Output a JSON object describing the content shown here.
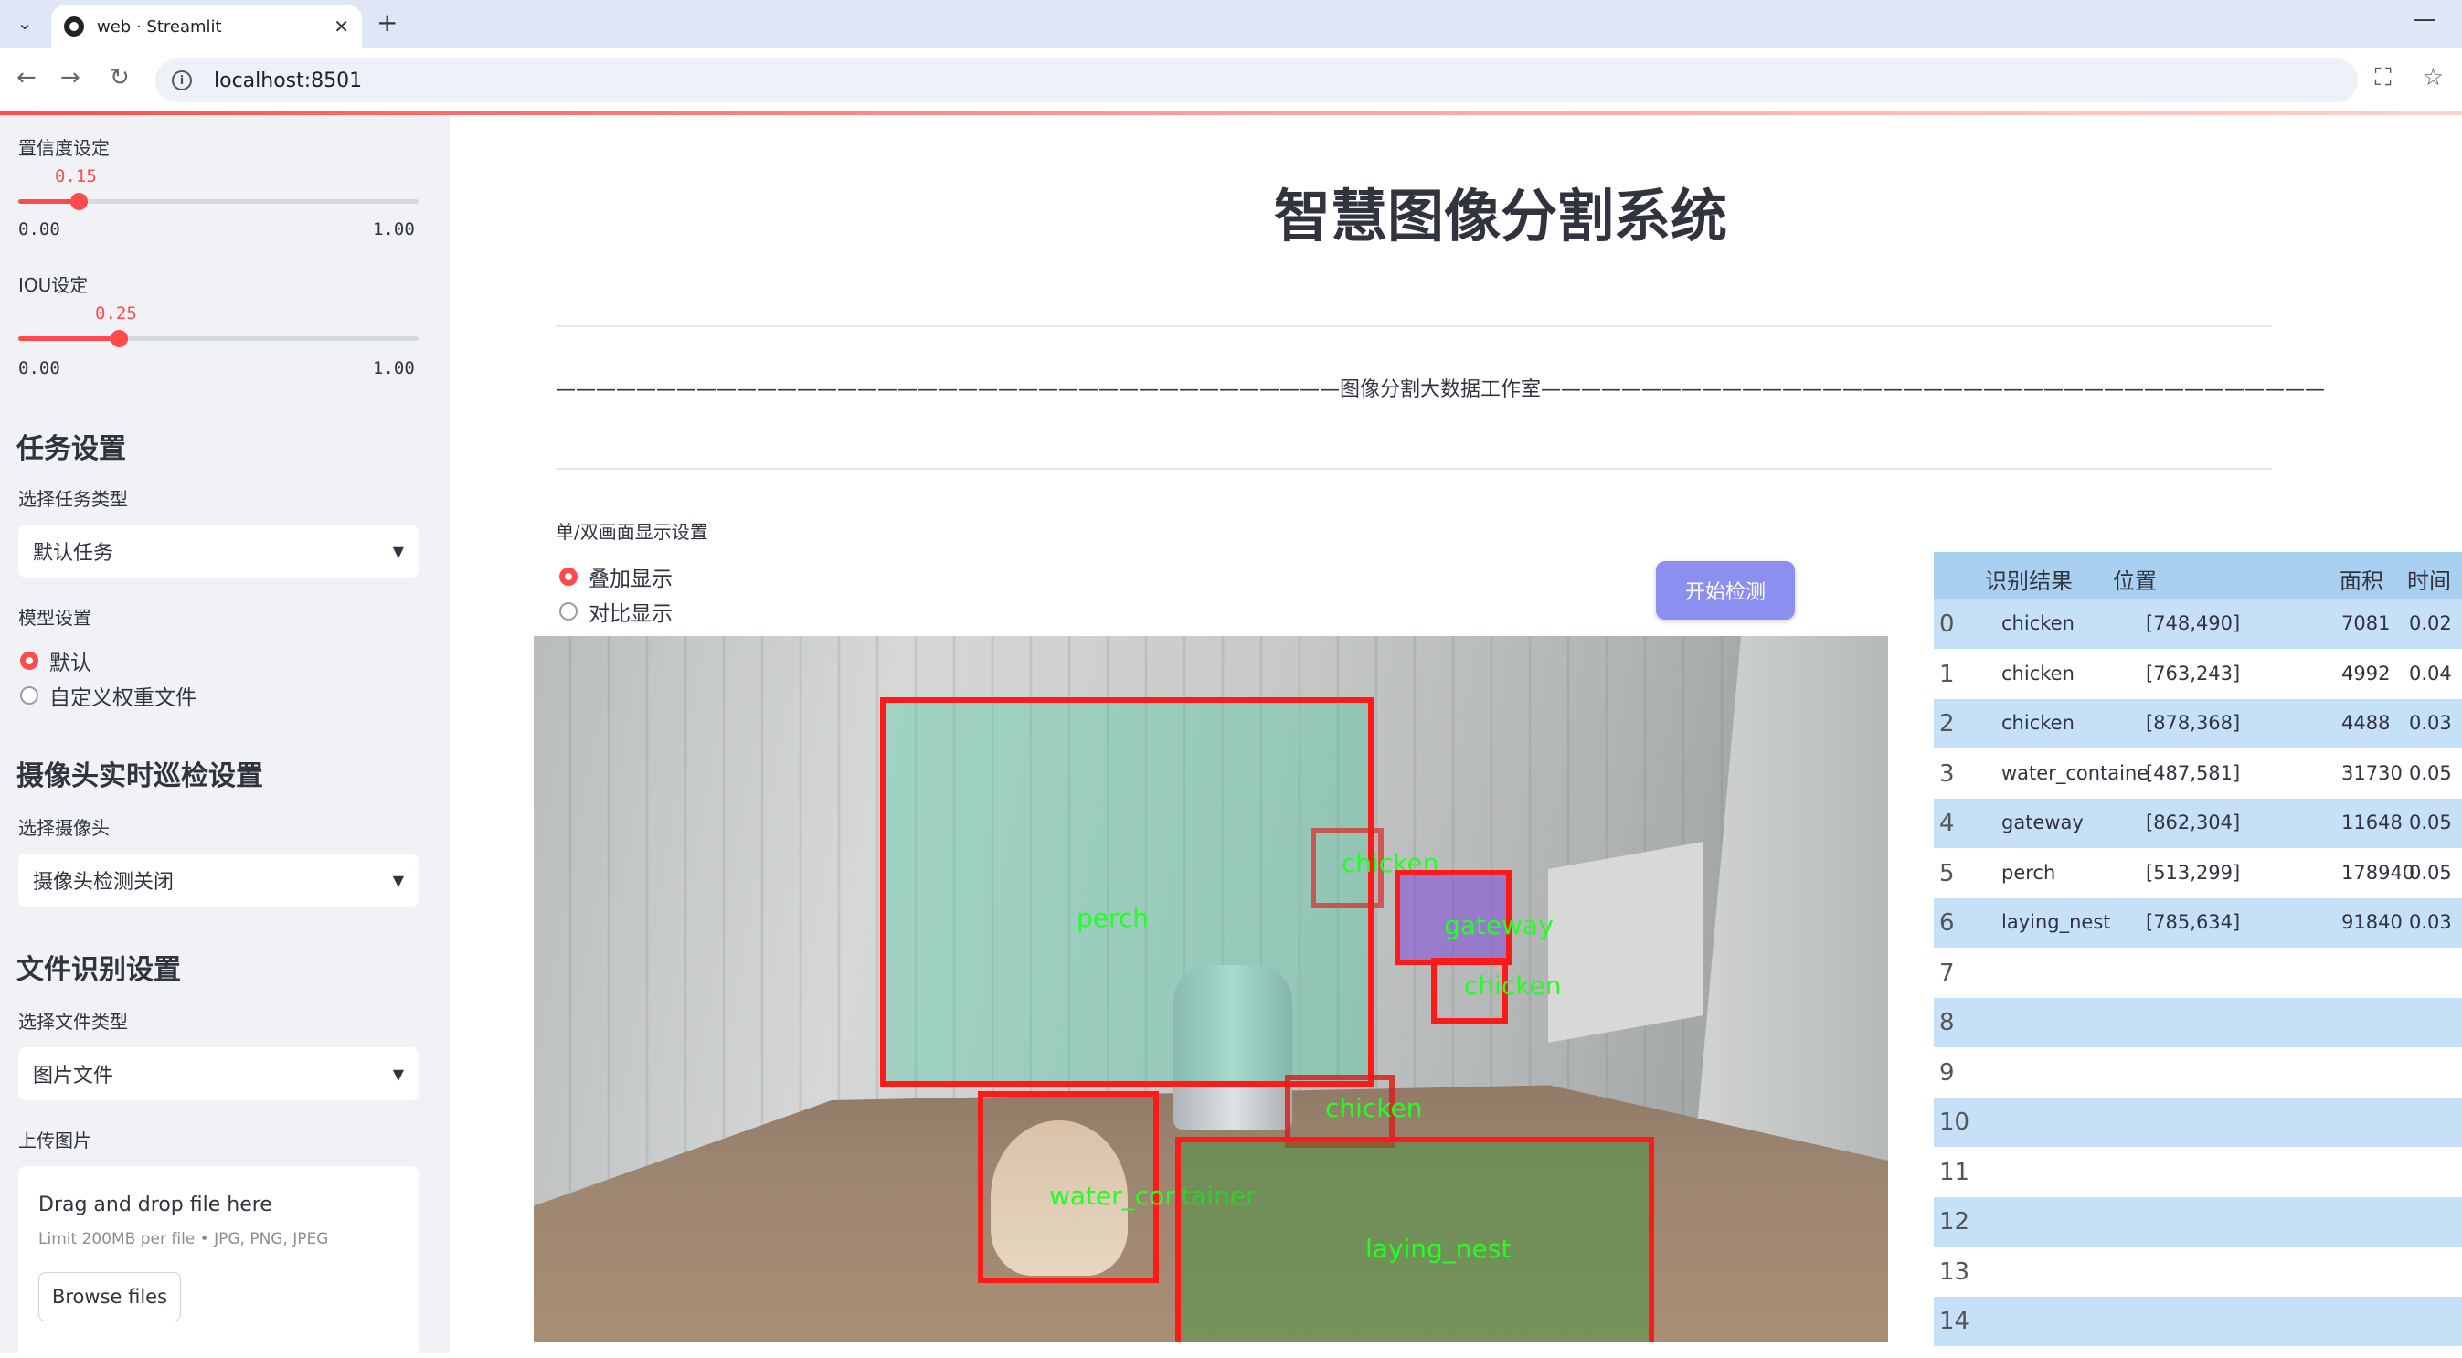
{
  "browser": {
    "tab_title": "web · Streamlit",
    "url": "localhost:8501"
  },
  "sidebar": {
    "confidence": {
      "label": "置信度设定",
      "value": "0.15",
      "value_fraction": 0.15,
      "min": "0.00",
      "max": "1.00"
    },
    "iou": {
      "label": "IOU设定",
      "value": "0.25",
      "value_fraction": 0.25,
      "min": "0.00",
      "max": "1.00"
    },
    "task_header": "任务设置",
    "task_type_label": "选择任务类型",
    "task_type_value": "默认任务",
    "model_label": "模型设置",
    "model_options": [
      "默认",
      "自定义权重文件"
    ],
    "camera_header": "摄像头实时巡检设置",
    "camera_label": "选择摄像头",
    "camera_value": "摄像头检测关闭",
    "file_header": "文件识别设置",
    "file_type_label": "选择文件类型",
    "file_type_value": "图片文件",
    "upload_label": "上传图片",
    "upload_title": "Drag and drop file here",
    "upload_limit": "Limit 200MB per file • JPG, PNG, JPEG",
    "browse_label": "Browse files"
  },
  "main": {
    "title": "智慧图像分割系统",
    "studio_line": "———————————————————————————————————————图像分割大数据工作室———————————————————————————————————————",
    "display_label": "单/双画面显示设置",
    "display_options": [
      "叠加显示",
      "对比显示"
    ],
    "start_button": "开始检测"
  },
  "detections": [
    {
      "label": "perch"
    },
    {
      "label": "chicken"
    },
    {
      "label": "gateway"
    },
    {
      "label": "chicken"
    },
    {
      "label": "chicken"
    },
    {
      "label": "water_container"
    },
    {
      "label": "laying_nest"
    }
  ],
  "colors": {
    "accent": "#ff4b4b",
    "box": "#ff1a1a",
    "label": "#22ff22",
    "button": "#8b8ff0",
    "table_header": "#a9d0f0",
    "table_stripe": "#c6e1f7"
  },
  "table": {
    "headers": [
      "识别结果",
      "位置",
      "面积",
      "时间"
    ],
    "rows": [
      {
        "idx": "0",
        "result": "chicken",
        "pos": "[748,490]",
        "area": "7081",
        "time": "0.02"
      },
      {
        "idx": "1",
        "result": "chicken",
        "pos": "[763,243]",
        "area": "4992",
        "time": "0.04"
      },
      {
        "idx": "2",
        "result": "chicken",
        "pos": "[878,368]",
        "area": "4488",
        "time": "0.03"
      },
      {
        "idx": "3",
        "result": "water_containe",
        "pos": "[487,581]",
        "area": "31730",
        "time": "0.05"
      },
      {
        "idx": "4",
        "result": "gateway",
        "pos": "[862,304]",
        "area": "11648",
        "time": "0.05"
      },
      {
        "idx": "5",
        "result": "perch",
        "pos": "[513,299]",
        "area": "178940",
        "time": "0.05"
      },
      {
        "idx": "6",
        "result": "laying_nest",
        "pos": "[785,634]",
        "area": "91840",
        "time": "0.03"
      },
      {
        "idx": "7",
        "result": "",
        "pos": "",
        "area": "",
        "time": ""
      },
      {
        "idx": "8",
        "result": "",
        "pos": "",
        "area": "",
        "time": ""
      },
      {
        "idx": "9",
        "result": "",
        "pos": "",
        "area": "",
        "time": ""
      },
      {
        "idx": "10",
        "result": "",
        "pos": "",
        "area": "",
        "time": ""
      },
      {
        "idx": "11",
        "result": "",
        "pos": "",
        "area": "",
        "time": ""
      },
      {
        "idx": "12",
        "result": "",
        "pos": "",
        "area": "",
        "time": ""
      },
      {
        "idx": "13",
        "result": "",
        "pos": "",
        "area": "",
        "time": ""
      },
      {
        "idx": "14",
        "result": "",
        "pos": "",
        "area": "",
        "time": ""
      }
    ]
  }
}
